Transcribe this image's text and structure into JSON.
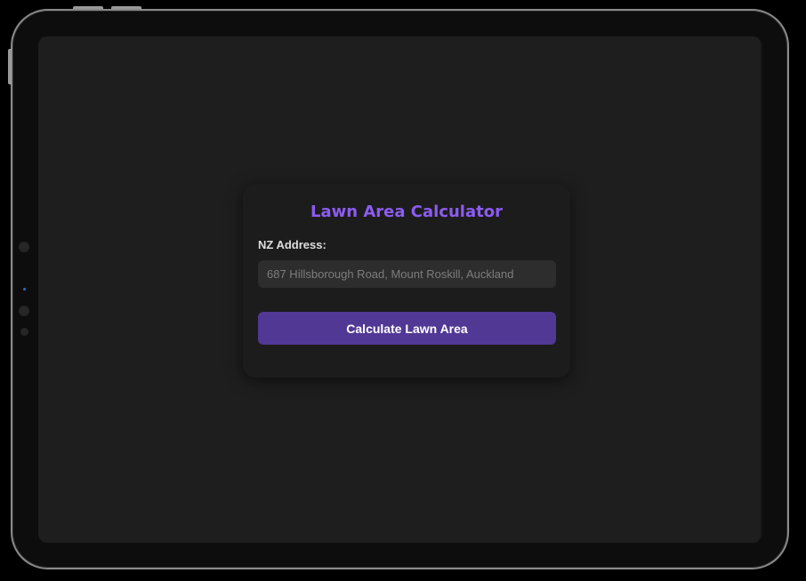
{
  "app": {
    "title": "Lawn Area Calculator",
    "accent_color": "#8c5cf0",
    "button_color": "#523895",
    "background_color": "#1e1e1e",
    "card_color": "#1c1c1c"
  },
  "form": {
    "address_label": "NZ Address:",
    "address_value": "",
    "address_placeholder": "687 Hillsborough Road, Mount Roskill, Auckland",
    "submit_label": "Calculate Lawn Area"
  }
}
